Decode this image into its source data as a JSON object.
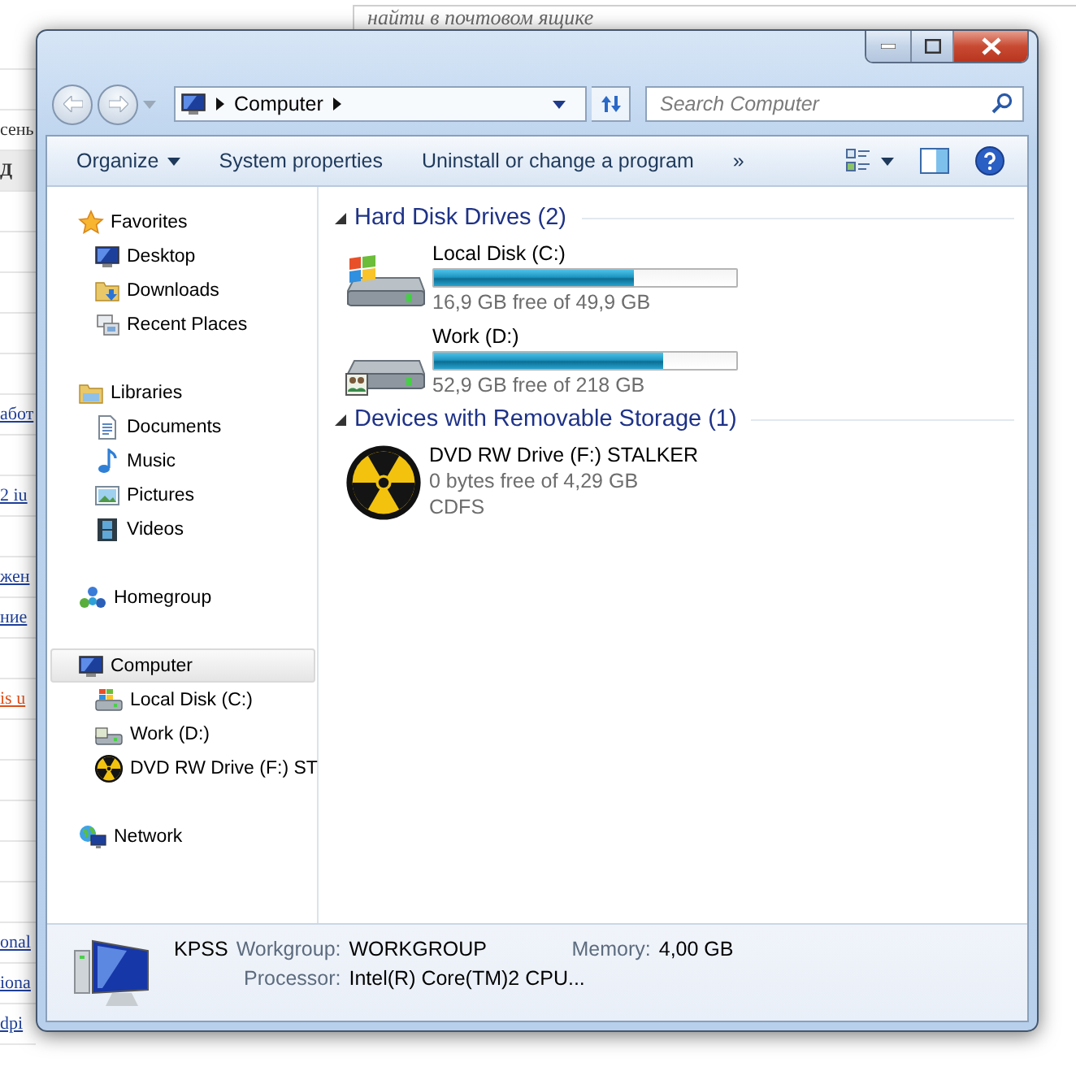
{
  "background_page": {
    "search": {
      "placeholder": "найти в почтовом ящике"
    },
    "fragments": [
      {
        "text": "сень",
        "kind": "text"
      },
      {
        "text": "Д",
        "kind": "heading"
      },
      {
        "text": "абот",
        "kind": "link",
        "color": "#1f3f99"
      },
      {
        "text": "2 iu",
        "kind": "link",
        "color": "#1f3f99"
      },
      {
        "text": "жен",
        "kind": "link",
        "color": "#1f3f99"
      },
      {
        "text": "ние",
        "kind": "link",
        "color": "#1f3f99"
      },
      {
        "text": "is u",
        "kind": "link",
        "color": "#e0501a"
      },
      {
        "text": "onal",
        "kind": "link",
        "color": "#1f3f99"
      },
      {
        "text": "iona",
        "kind": "link",
        "color": "#1f3f99"
      },
      {
        "text": "dpi",
        "kind": "link",
        "color": "#1f3f99"
      }
    ]
  },
  "window": {
    "address": {
      "crumbs": [
        "Computer"
      ]
    },
    "search": {
      "placeholder": "Search Computer"
    }
  },
  "toolbar": {
    "items": [
      {
        "label": "Organize",
        "dropdown": true
      },
      {
        "label": "System properties",
        "dropdown": false
      },
      {
        "label": "Uninstall or change a program",
        "dropdown": false
      }
    ],
    "overflow": "»"
  },
  "nav": {
    "groups": [
      {
        "label": "Favorites",
        "selected": false,
        "children": [
          {
            "label": "Desktop"
          },
          {
            "label": "Downloads"
          },
          {
            "label": "Recent Places"
          }
        ]
      },
      {
        "label": "Libraries",
        "selected": false,
        "children": [
          {
            "label": "Documents"
          },
          {
            "label": "Music"
          },
          {
            "label": "Pictures"
          },
          {
            "label": "Videos"
          }
        ]
      },
      {
        "label": "Homegroup",
        "selected": false
      },
      {
        "label": "Computer",
        "selected": true,
        "children": [
          {
            "label": "Local Disk (C:)"
          },
          {
            "label": "Work (D:)"
          },
          {
            "label": "DVD RW Drive (F:) ST"
          }
        ]
      },
      {
        "label": "Network",
        "selected": false
      }
    ]
  },
  "sections": [
    {
      "title": "Hard Disk Drives (2)",
      "expanded": true,
      "items": [
        {
          "kind": "system-disk",
          "name": "Local Disk (C:)",
          "level": 0.66,
          "space": "16,9 GB free of 49,9 GB"
        },
        {
          "kind": "disk",
          "name": "Work (D:)",
          "level": 0.76,
          "space": "52,9 GB free of 218 GB"
        }
      ]
    },
    {
      "title": "Devices with Removable Storage (1)",
      "expanded": true,
      "items": [
        {
          "kind": "optical",
          "name": "DVD RW Drive (F:) STALKER",
          "space": "0 bytes free of 4,29 GB",
          "filesystem": "CDFS"
        }
      ]
    }
  ],
  "details": {
    "name": "KPSS",
    "fields": [
      {
        "label": "Workgroup:",
        "value": "WORKGROUP"
      },
      {
        "label": "Memory:",
        "value": "4,00 GB"
      },
      {
        "label": "Processor:",
        "value": "Intel(R) Core(TM)2 CPU..."
      }
    ]
  }
}
